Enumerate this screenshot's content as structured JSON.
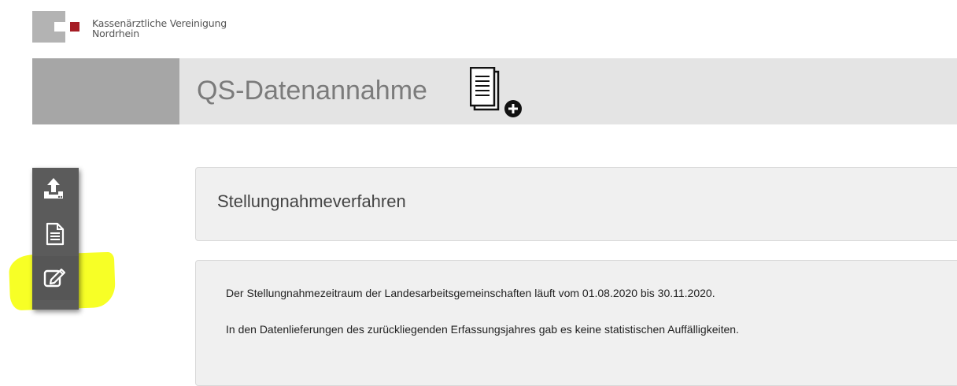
{
  "branding": {
    "org_line1": "Kassenärztliche Vereinigung",
    "org_line2": "Nordrhein",
    "colors": {
      "logo_gray": "#b3b3b3",
      "logo_red": "#a51c24"
    }
  },
  "header": {
    "title": "QS-Datenannahme",
    "icon": "document-add-icon"
  },
  "sidebar": {
    "items": [
      {
        "name": "upload",
        "icon": "upload-icon"
      },
      {
        "name": "document",
        "icon": "document-icon"
      },
      {
        "name": "edit",
        "icon": "edit-icon",
        "highlighted": true
      }
    ],
    "highlight_color": "#f6ff00"
  },
  "main": {
    "section_title": "Stellungnahmeverfahren",
    "paragraphs": [
      "Der Stellungnahmezeitraum der Landesarbeitsgemeinschaften läuft vom 01.08.2020 bis 30.11.2020.",
      "In den Datenlieferungen des zurückliegenden Erfassungsjahres gab es keine statistischen Auffälligkeiten."
    ]
  }
}
